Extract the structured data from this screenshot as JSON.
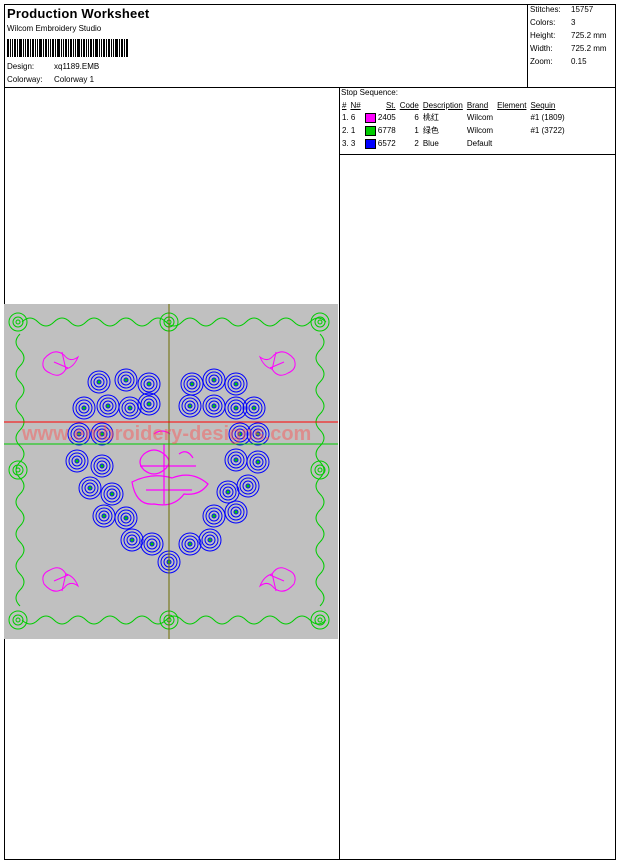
{
  "header": {
    "title": "Production Worksheet",
    "studio": "Wilcom Embroidery Studio",
    "design_label": "Design:",
    "design_value": "xq1189.EMB",
    "colorway_label": "Colorway:",
    "colorway_value": "Colorway 1"
  },
  "stats": [
    {
      "label": "Stitches:",
      "value": "15757"
    },
    {
      "label": "Colors:",
      "value": "3"
    },
    {
      "label": "Height:",
      "value": "725.2 mm"
    },
    {
      "label": "Width:",
      "value": "725.2 mm"
    },
    {
      "label": "Zoom:",
      "value": "0.15"
    }
  ],
  "stop_sequence": {
    "title": "Stop Sequence:",
    "columns": [
      "#",
      "N#",
      "St.",
      "Code",
      "Description",
      "Brand",
      "Element",
      "Sequin"
    ],
    "rows": [
      {
        "num": "1. 6",
        "color": "#ff00ff",
        "code": "2405",
        "count": "6",
        "desc": "桃红",
        "brand": "Wilcom",
        "element": "",
        "sequin": "#1 (1809)"
      },
      {
        "num": "2. 1",
        "color": "#00cc00",
        "code": "6778",
        "count": "1",
        "desc": "绿色",
        "brand": "Wilcom",
        "element": "",
        "sequin": "#1 (3722)"
      },
      {
        "num": "3. 3",
        "color": "#0000ff",
        "code": "6572",
        "count": "2",
        "desc": "Blue",
        "brand": "Default",
        "element": "",
        "sequin": ""
      }
    ]
  },
  "design": {
    "background": "#c0c0c0",
    "watermark": "www.embroidery-designs.com",
    "colors": {
      "pink": "#ff00ff",
      "green": "#00cc00",
      "blue": "#0000ff",
      "axis": "#6b6b00",
      "red": "#ff0000"
    }
  }
}
